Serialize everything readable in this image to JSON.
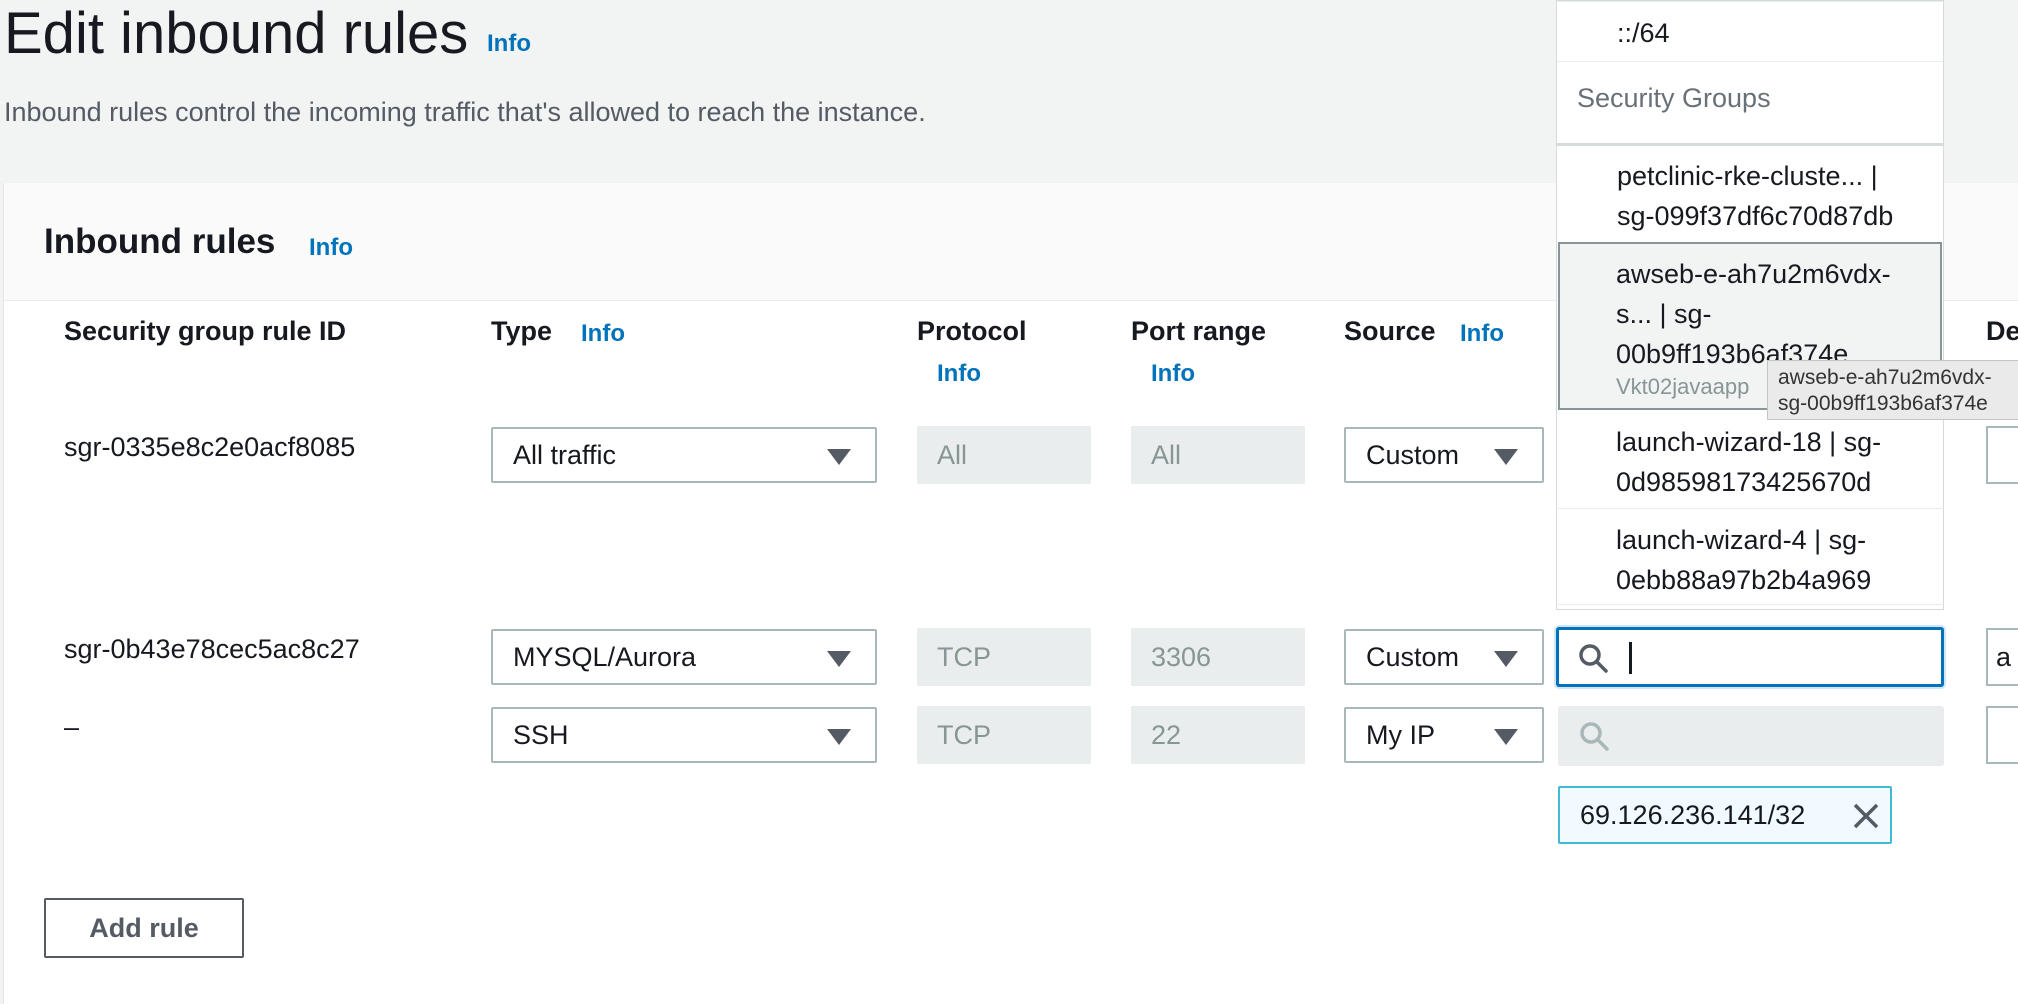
{
  "header": {
    "title": "Edit inbound rules",
    "title_info": "Info",
    "description": "Inbound rules control the incoming traffic that's allowed to reach the instance."
  },
  "panel": {
    "title": "Inbound rules",
    "info": "Info",
    "columns": {
      "rule_id": "Security group rule ID",
      "type": "Type",
      "type_info": "Info",
      "protocol": "Protocol",
      "protocol_info": "Info",
      "port_range": "Port range",
      "port_info": "Info",
      "source": "Source",
      "source_info": "Info",
      "description_partial": "De"
    },
    "rows": [
      {
        "id": "sgr-0335e8c2e0acf8085",
        "type": "All traffic",
        "protocol": "All",
        "port": "All",
        "source": "Custom"
      },
      {
        "id": "sgr-0b43e78cec5ac8c27",
        "type": "MYSQL/Aurora",
        "protocol": "TCP",
        "port": "3306",
        "source": "Custom",
        "desc_partial": "a"
      },
      {
        "id": "–",
        "type": "SSH",
        "protocol": "TCP",
        "port": "22",
        "source": "My IP"
      }
    ],
    "ip_token": "69.126.236.141/32",
    "add_rule": "Add rule"
  },
  "dropdown": {
    "top_item": "::/64",
    "group_label": "Security Groups",
    "items": [
      {
        "line1": "petclinic-rke-cluste... |",
        "line2": "sg-099f37df6c70d87db"
      },
      {
        "line1": "awseb-e-ah7u2m6vdx-",
        "line2": "s... | sg-",
        "line3": "00b9ff193b6af374e",
        "sub": "Vkt02javaapp"
      },
      {
        "line1": "launch-wizard-18 | sg-",
        "line2": "0d98598173425670d"
      },
      {
        "line1": "launch-wizard-4 | sg-",
        "line2": "0ebb88a97b2b4a969"
      }
    ]
  },
  "tooltip": {
    "line1": "awseb-e-ah7u2m6vdx-",
    "line2": "sg-00b9ff193b6af374e"
  },
  "icons": {
    "search": "search-icon",
    "caret": "caret-down-icon",
    "close": "close-icon"
  }
}
